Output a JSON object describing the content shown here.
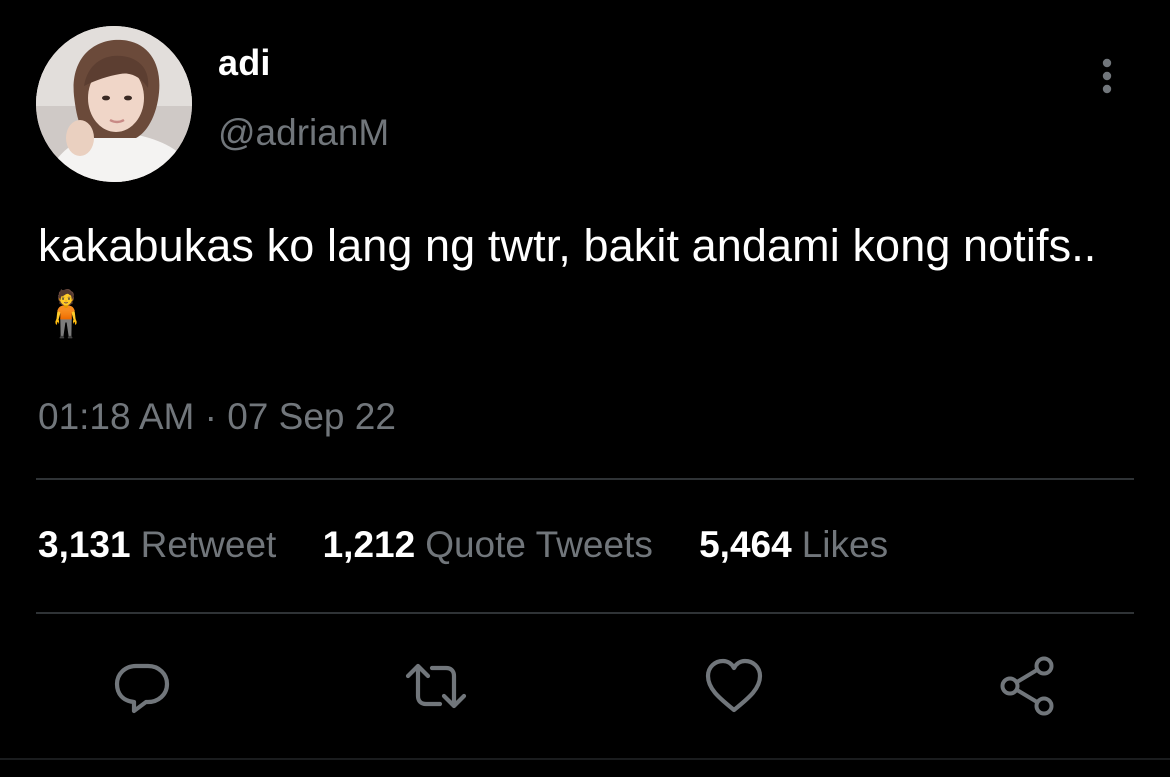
{
  "tweet": {
    "display_name": "adi",
    "handle": "@adrianM",
    "text": "kakabukas ko lang ng twtr, bakit andami kong notifs.. 🧍",
    "timestamp": "01:18 AM · 07 Sep 22"
  },
  "stats": [
    {
      "count": "3,131",
      "label": "Retweet"
    },
    {
      "count": "1,212",
      "label": "Quote Tweets"
    },
    {
      "count": "5,464",
      "label": "Likes"
    }
  ],
  "icons": {
    "more": "more-vertical-icon",
    "reply": "reply-icon",
    "retweet": "retweet-icon",
    "like": "heart-icon",
    "share": "share-icon"
  },
  "colors": {
    "background": "#000000",
    "primary_text": "#ffffff",
    "secondary_text": "#71767b",
    "divider": "#2f3336"
  }
}
